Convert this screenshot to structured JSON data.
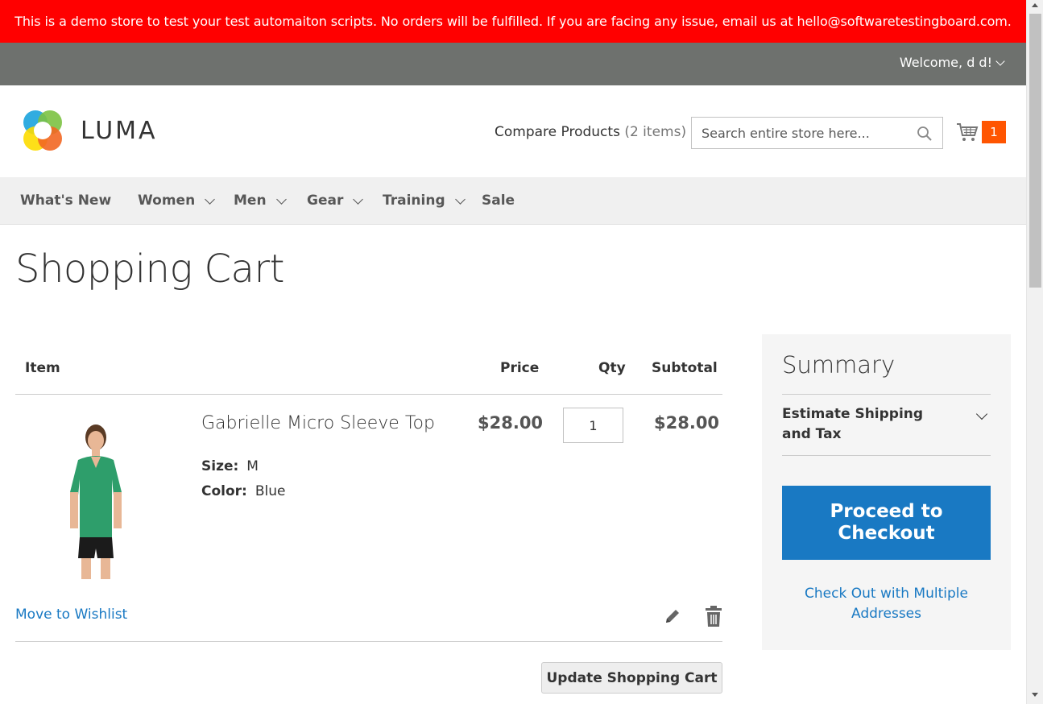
{
  "banner": {
    "text": "This is a demo store to test your test automaiton scripts. No orders will be fulfilled. If you are facing any issue, email us at hello@softwaretestingboard.com."
  },
  "panel": {
    "welcome": "Welcome, d d!"
  },
  "header": {
    "logo_text": "LUMA",
    "compare_label": "Compare Products",
    "compare_count": "(2 items)",
    "search_placeholder": "Search entire store here...",
    "cart_count": "1"
  },
  "nav": {
    "items": [
      {
        "label": "What's New"
      },
      {
        "label": "Women"
      },
      {
        "label": "Men"
      },
      {
        "label": "Gear"
      },
      {
        "label": "Training"
      },
      {
        "label": "Sale"
      }
    ]
  },
  "page": {
    "title": "Shopping Cart"
  },
  "cart": {
    "columns": {
      "item": "Item",
      "price": "Price",
      "qty": "Qty",
      "subtotal": "Subtotal"
    },
    "items": [
      {
        "name": "Gabrielle Micro Sleeve Top",
        "size_label": "Size:",
        "size": "M",
        "color_label": "Color:",
        "color": "Blue",
        "price": "$28.00",
        "qty": "1",
        "subtotal": "$28.00",
        "wishlist_label": "Move to Wishlist"
      }
    ],
    "update_button": "Update Shopping Cart"
  },
  "summary": {
    "title": "Summary",
    "estimate_label": "Estimate Shipping and Tax",
    "checkout_button": "Proceed to Checkout",
    "multi_address_link": "Check Out with Multiple Addresses"
  },
  "colors": {
    "banner": "#ff0000",
    "panel": "#6e716e",
    "primary": "#1979c3",
    "cart_badge": "#ff5501"
  },
  "icons": {
    "search": "search-icon",
    "cart": "cart-icon",
    "edit": "pencil-icon",
    "delete": "trash-icon"
  }
}
